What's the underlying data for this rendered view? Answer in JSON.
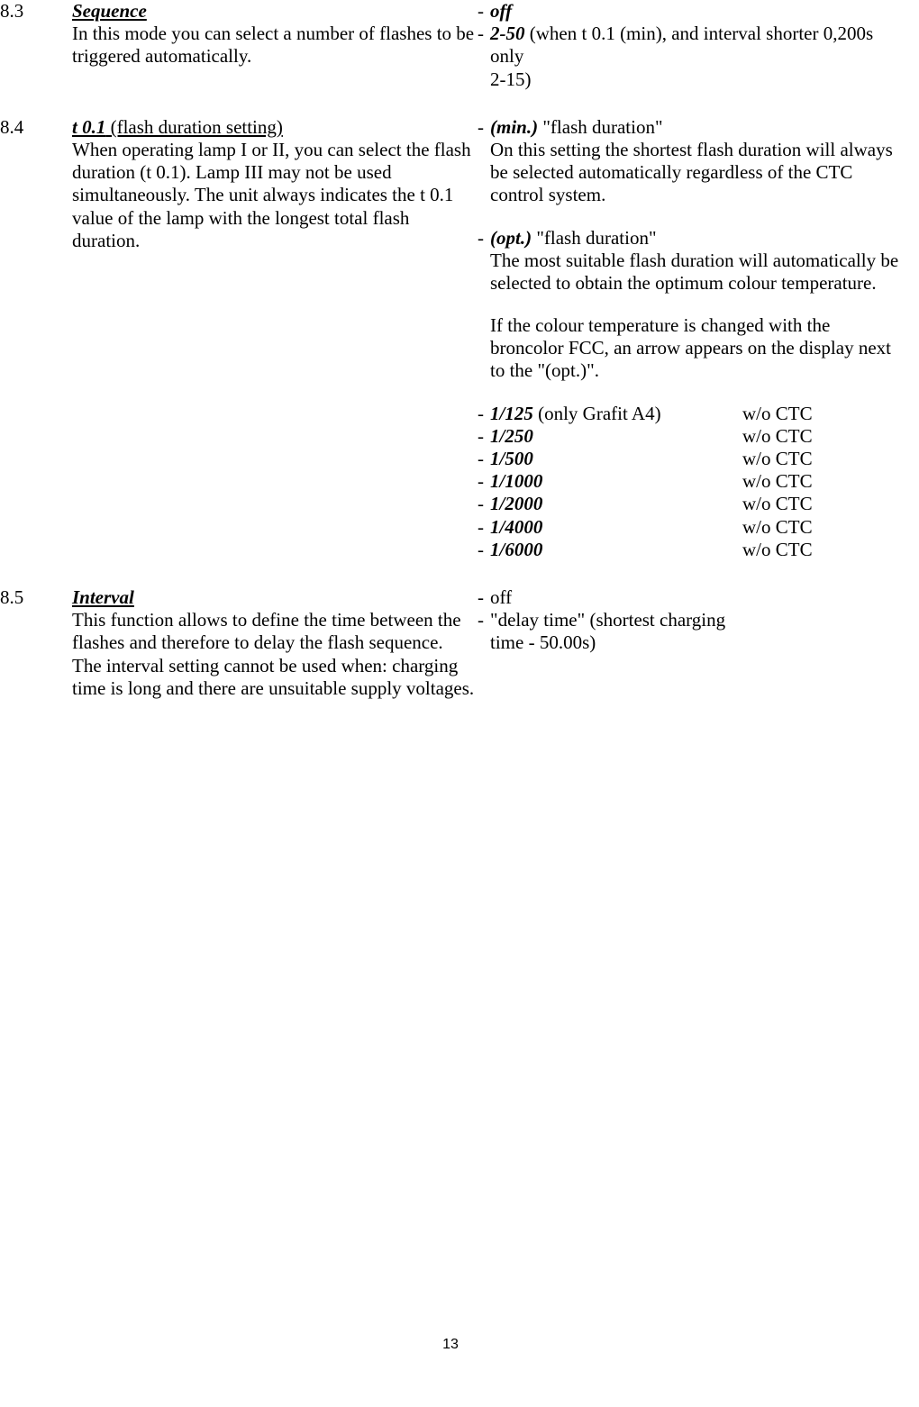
{
  "s83": {
    "num": "8.3",
    "title": "Sequence",
    "left": "In this mode you can select a number of flashes to be triggered  automatically.",
    "r1_bold": "off",
    "r2_bold": "2-50",
    "r2_rest": " (when t 0.1 (min), and interval shorter 0,200s only",
    "r2_cont": " 2-15)"
  },
  "s84": {
    "num": "8.4",
    "title_bold": "t 0.1",
    "title_rest": " (flash duration setting)",
    "left": "When operating lamp I or II, you can select the flash duration (t 0.1). Lamp III may not be used simultaneously. The unit always indicates the t 0.1 value of the lamp with the longest total flash duration.",
    "min_b": "(min.)",
    "min_q": " \"flash duration\"",
    "min_desc": "On this setting the shortest flash duration will always be selected automatically regardless of the CTC control system.",
    "opt_b": "(opt.)",
    "opt_q": " \"flash duration\"",
    "opt_desc1": "The most suitable flash duration will automatically be selected to obtain the optimum colour temperature.",
    "opt_desc2": "If the colour temperature is changed with the broncolor FCC, an arrow appears on the display next to the \"(opt.)\".",
    "speeds": [
      {
        "v": "1/125",
        "note": " (only Grafit A4)",
        "r": "w/o CTC"
      },
      {
        "v": "1/250",
        "note": "",
        "r": "w/o CTC"
      },
      {
        "v": "1/500",
        "note": "",
        "r": "w/o CTC"
      },
      {
        "v": "1/1000",
        "note": "",
        "r": "w/o CTC"
      },
      {
        "v": "1/2000",
        "note": "",
        "r": "w/o CTC"
      },
      {
        "v": "1/4000",
        "note": "",
        "r": "w/o CTC"
      },
      {
        "v": "1/6000",
        "note": "",
        "r": "w/o CTC"
      }
    ]
  },
  "s85": {
    "num": "8.5",
    "title": "Interval",
    "left1": "This function allows to define the time between the flashes and therefore to delay the flash sequence.",
    "left2": "The interval setting cannot be used when: charging time is long and there are unsuitable supply voltages.",
    "r1": "off",
    "r2a": "\"delay time\" (shortest charging",
    "r2b": "time - 50.00s)"
  },
  "pagenum": "13"
}
